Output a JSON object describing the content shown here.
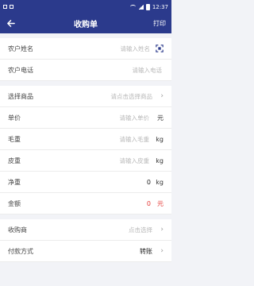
{
  "status": {
    "time": "12:37"
  },
  "nav": {
    "title": "收购单",
    "print_label": "打印"
  },
  "farmer_name": {
    "label": "农户姓名",
    "placeholder": "请输入姓名"
  },
  "farmer_phone": {
    "label": "农户电话",
    "placeholder": "请输入电话"
  },
  "product": {
    "label": "选择商品",
    "placeholder": "请点击选择商品"
  },
  "unit_price": {
    "label": "单价",
    "placeholder": "请输入单价",
    "unit": "元"
  },
  "gross_weight": {
    "label": "毛重",
    "placeholder": "请输入毛重",
    "unit": "kg"
  },
  "tare_weight": {
    "label": "皮重",
    "placeholder": "请输入皮重",
    "unit": "kg"
  },
  "net_weight": {
    "label": "净重",
    "value": "0",
    "unit": "kg"
  },
  "amount": {
    "label": "金额",
    "value": "0",
    "unit": "元"
  },
  "buyer": {
    "label": "收购商",
    "placeholder": "点击选择"
  },
  "payment": {
    "label": "付款方式",
    "value": "转账"
  },
  "colors": {
    "header": "#2b3a8c",
    "amount": "#e53935"
  }
}
